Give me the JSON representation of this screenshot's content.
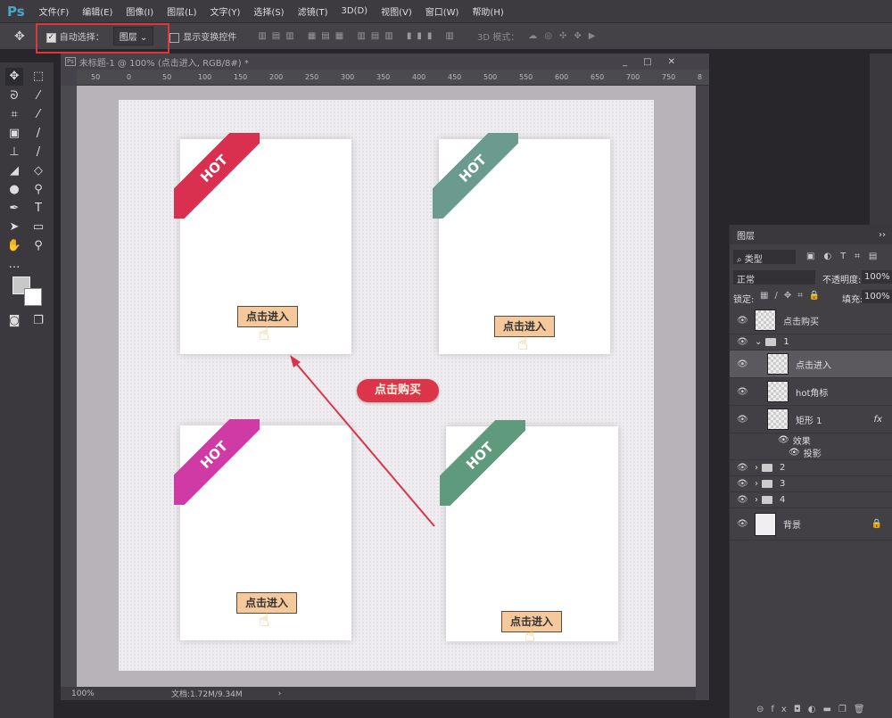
{
  "app": {
    "logo": "Ps"
  },
  "menu": [
    "文件(F)",
    "编辑(E)",
    "图像(I)",
    "图层(L)",
    "文字(Y)",
    "选择(S)",
    "滤镜(T)",
    "3D(D)",
    "视图(V)",
    "窗口(W)",
    "帮助(H)"
  ],
  "options": {
    "auto_select_label": "自动选择：",
    "auto_select_checked": true,
    "auto_select_value": "图层",
    "show_transform_label": "显示变换控件",
    "show_transform_checked": false,
    "mode_3d_label": "3D 模式："
  },
  "document": {
    "title": "未标题-1 @ 100% (点击进入, RGB/8#) *",
    "zoom": "100%",
    "doc_size": "文档:1.72M/9.34M",
    "ruler_labels": [
      "50",
      "0",
      "50",
      "100",
      "150",
      "200",
      "250",
      "300",
      "350",
      "400",
      "450",
      "500",
      "550",
      "600",
      "650",
      "700",
      "750",
      "8"
    ]
  },
  "canvas": {
    "cards": [
      {
        "hot": "HOT",
        "button": "点击进入",
        "color": "#d8304e"
      },
      {
        "hot": "HOT",
        "button": "点击进入",
        "color": "#6b9b8e"
      },
      {
        "hot": "HOT",
        "button": "点击进入",
        "color": "#cf3aa5"
      },
      {
        "hot": "HOT",
        "button": "点击进入",
        "color": "#5e9a7b"
      }
    ],
    "buy_button": "点击购买",
    "arrow_color": "#d8354a"
  },
  "layers_panel": {
    "tab": "图层",
    "filter_label": "类型",
    "blend_mode": "正常",
    "opacity_label": "不透明度:",
    "opacity": "100%",
    "lock_label": "锁定:",
    "fill_label": "填充:",
    "fill": "100%",
    "layers": [
      {
        "name": "点击购买"
      },
      {
        "name": "1"
      },
      {
        "name": "点击进入"
      },
      {
        "name": "hot角标"
      },
      {
        "name": "矩形 1",
        "fx": "fx"
      },
      {
        "name": "效果"
      },
      {
        "name": "投影"
      },
      {
        "name": "2"
      },
      {
        "name": "3"
      },
      {
        "name": "4"
      },
      {
        "name": "背景"
      }
    ]
  }
}
